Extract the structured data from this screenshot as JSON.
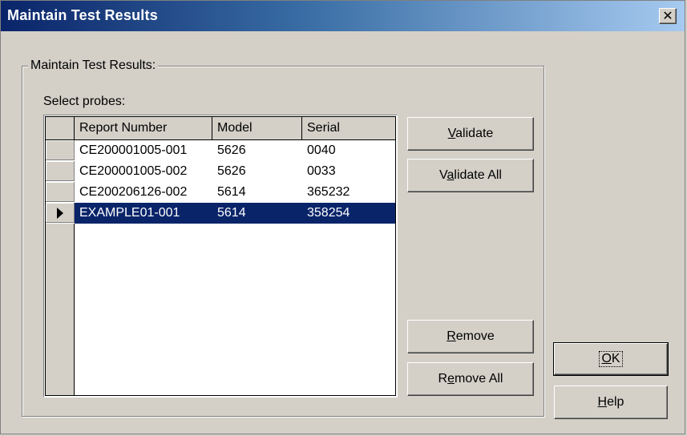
{
  "window": {
    "title": "Maintain Test Results",
    "close_glyph": "✕"
  },
  "group": {
    "label": "Maintain Test Results:"
  },
  "probes": {
    "label": "Select probes:",
    "columns": [
      "Report Number",
      "Model",
      "Serial"
    ],
    "rows": [
      {
        "report": "CE200001005-001",
        "model": "5626",
        "serial": "0040",
        "selected": false
      },
      {
        "report": "CE200001005-002",
        "model": "5626",
        "serial": "0033",
        "selected": false
      },
      {
        "report": "CE200206126-002",
        "model": "5614",
        "serial": "365232",
        "selected": false
      },
      {
        "report": "EXAMPLE01-001",
        "model": "5614",
        "serial": "358254",
        "selected": true
      }
    ]
  },
  "buttons": {
    "validate_pre": "",
    "validate_u": "V",
    "validate_post": "alidate",
    "validate_all_pre": "V",
    "validate_all_u": "a",
    "validate_all_post": "lidate All",
    "remove_pre": "",
    "remove_u": "R",
    "remove_post": "emove",
    "remove_all_pre": "R",
    "remove_all_u": "e",
    "remove_all_post": "move All",
    "ok_pre": "",
    "ok_u": "O",
    "ok_post": "K",
    "help_pre": "",
    "help_u": "H",
    "help_post": "elp"
  }
}
